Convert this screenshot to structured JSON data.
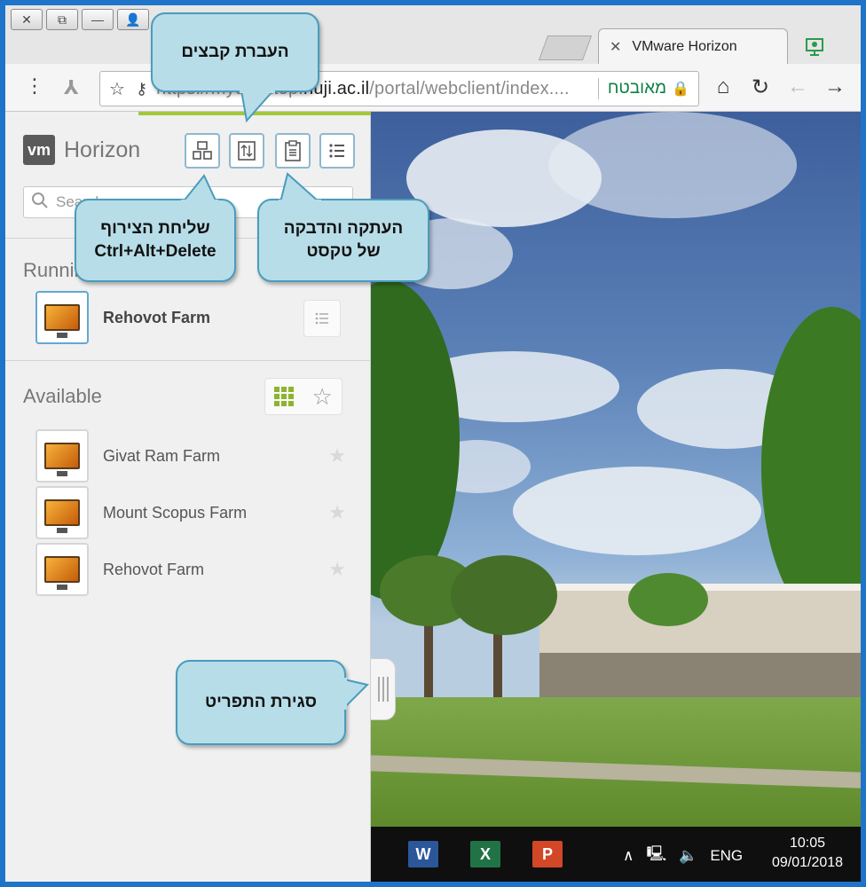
{
  "window_buttons": [
    "✕",
    "⧉",
    "—",
    "👤"
  ],
  "tab": {
    "close": "✕",
    "title": "VMware Horizon"
  },
  "address_bar": {
    "url_scheme": "https://",
    "url_host_prefix": "mydesktop.",
    "url_host_main": "huji.ac.il",
    "url_path": "/portal/webclient/index....",
    "secure_label": "מאובטח"
  },
  "sidebar": {
    "logo_badge": "vm",
    "logo_text": "Horizon",
    "search_placeholder": "Search",
    "running_title": "Running",
    "running_items": [
      {
        "name": "Rehovot Farm"
      }
    ],
    "available_title": "Available",
    "available_items": [
      {
        "name": "Givat Ram Farm"
      },
      {
        "name": "Mount Scopus Farm"
      },
      {
        "name": "Rehovot Farm"
      }
    ]
  },
  "taskbar": {
    "apps": [
      {
        "name": "word",
        "letter": "W",
        "color": "#2b579a"
      },
      {
        "name": "excel",
        "letter": "X",
        "color": "#217346"
      },
      {
        "name": "powerpoint",
        "letter": "P",
        "color": "#d24726"
      }
    ],
    "language": "ENG",
    "time": "10:05",
    "date": "09/01/2018"
  },
  "callouts": {
    "file_transfer": "העברת קבצים",
    "send_combo_line1": "שליחת הצירוף",
    "send_combo_line2": "Ctrl+Alt+Delete",
    "copy_paste_line1": "העתקה והדבקה",
    "copy_paste_line2": "של טקסט",
    "close_menu": "סגירת התפריט"
  }
}
